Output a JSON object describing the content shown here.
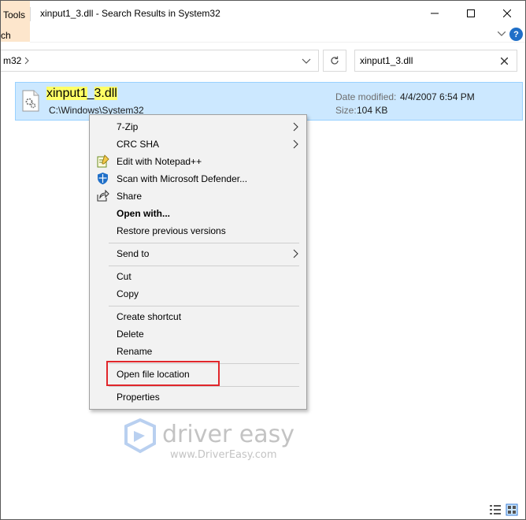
{
  "window": {
    "title": "xinput1_3.dll - Search Results in System32",
    "tools_tab": "Tools",
    "search_tab_fragment": "ch"
  },
  "ribbon": {
    "help_label": "?"
  },
  "address": {
    "path_fragment": "m32"
  },
  "search": {
    "value": "xinput1_3.dll"
  },
  "result": {
    "name_hl_1": "xinput1",
    "name_mid": "_",
    "name_hl_2": "3.dll",
    "path": "C:\\Windows\\System32",
    "date_label": "Date modified:",
    "date_value": "4/4/2007 6:54 PM",
    "size_label": "Size:",
    "size_value": "104 KB"
  },
  "context_menu": {
    "items": [
      {
        "label": "7-Zip"
      },
      {
        "label": "CRC SHA"
      },
      {
        "label": "Edit with Notepad++"
      },
      {
        "label": "Scan with Microsoft Defender..."
      },
      {
        "label": "Share"
      },
      {
        "label": "Open with..."
      },
      {
        "label": "Restore previous versions"
      },
      {
        "label": "Send to"
      },
      {
        "label": "Cut"
      },
      {
        "label": "Copy"
      },
      {
        "label": "Create shortcut"
      },
      {
        "label": "Delete"
      },
      {
        "label": "Rename"
      },
      {
        "label": "Open file location"
      },
      {
        "label": "Properties"
      }
    ]
  },
  "watermark": {
    "brand": "driver easy",
    "url": "www.DriverEasy.com"
  },
  "colors": {
    "selection": "#cce8ff",
    "highlight_border": "#e1262b",
    "tools_tab": "#fde6cc",
    "search_highlight": "#ffff66"
  }
}
